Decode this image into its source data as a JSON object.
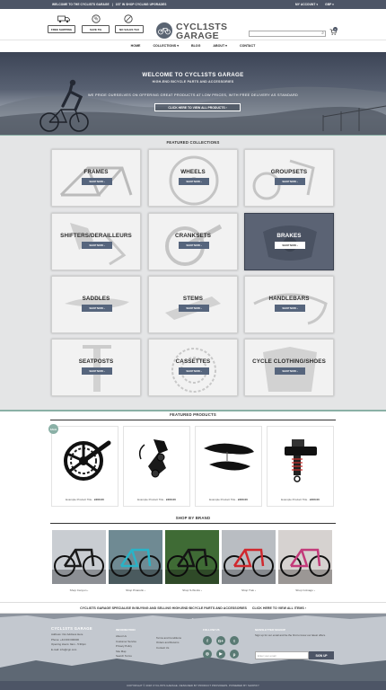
{
  "topbar": {
    "left": [
      "WELCOME TO THE CYCLISTS GARAGE",
      "|",
      "1ST IN SHOP CYCLING UPGRADES"
    ],
    "account": "MY ACCOUNT",
    "currency": "GBP"
  },
  "header": {
    "badges": [
      "FREE SHIPPING",
      "SAVE 5%",
      "NO SALES TAX"
    ],
    "badge_icons": [
      "truck-icon",
      "percent-icon",
      "tag-icon"
    ],
    "logo_line1": "CYCL1STS",
    "logo_line2": "GARAGE",
    "cart_count": "0",
    "search_icon": "search-icon"
  },
  "nav": {
    "items": [
      "HOME",
      "COLLECTIONS ▾",
      "BLOG",
      "ABOUT ▾",
      "CONTACT"
    ]
  },
  "hero": {
    "title": "WELCOME TO CYCL1STS GARAGE",
    "subtitle": "HIGH-END BICYCLE PARTS AND ACCESSORIES",
    "tagline": "WE PRIDE OURSELVES ON OFFERING GREAT PRODUCTS AT LOW PRICES, WITH FREE DELIVERY AS STANDARD",
    "cta": "CLICK HERE TO VIEW ALL PRODUCTS ›"
  },
  "collections": {
    "title": "FEATURED COLLECTIONS",
    "button": "SHOP NOW ›",
    "items": [
      "FRAMES",
      "WHEELS",
      "GROUPSETS",
      "SHIFTERS/DERAILLEURS",
      "CRANKSETS",
      "BRAKES",
      "SADDLES",
      "STEMS",
      "HANDLEBARS",
      "SEATPOSTS",
      "CASSETTES",
      "CYCLE CLOTHING/SHOES"
    ],
    "highlighted": "BRAKES"
  },
  "products": {
    "title": "FEATURED PRODUCTS",
    "sale_label": "SALE",
    "items": [
      {
        "name": "Example Product Title",
        "price": "£000.00"
      },
      {
        "name": "Example Product Title",
        "price": "£000.00"
      },
      {
        "name": "Example Product Title",
        "price": "£000.00"
      },
      {
        "name": "Example Product Title",
        "price": "£000.00"
      }
    ]
  },
  "brands": {
    "title": "SHOP BY BRAND",
    "items": [
      "Shop Canyon ›",
      "Shop Pinarello ›",
      "Shop S-Works ›",
      "Shop Trek ›",
      "Shop Colnago ›"
    ]
  },
  "band": {
    "text": "CYCLISTS GARAGE SPECIALISE IN BUYING AND SELLING HIGH-END BICYCLE PARTS AND ACCESSORIES",
    "link": "CLICK HERE TO VIEW ALL ITEMS ›"
  },
  "footer": {
    "logo": "CYCL1STS GARAGE",
    "contact": [
      "Address: Our Address Here",
      "Phone: +44 000 000000",
      "Opening Hours: 9am - 5:30pm",
      "E-mail: info@cgn.com"
    ],
    "info_title": "INFORMATION",
    "info_links": [
      "About Us",
      "Customer Service",
      "Privacy Policy",
      "Site Map",
      "Search Terms"
    ],
    "info_links2": [
      "Terms and Conditions",
      "Orders and Returns",
      "Contact Us"
    ],
    "follow_title": "FOLLOW US",
    "social": [
      "f",
      "G+",
      "t",
      "◎",
      "▶",
      "p"
    ],
    "news_title": "NEWSLETTER SIGNUP",
    "news_text": "Sign up for our email and be the first to know our latest offers.",
    "news_placeholder": "Enter your email",
    "news_button": "SIGN UP",
    "copyright": "COPYRIGHT © 2018 CYCLISTS GARAGE. DESIGNED BY PRODUCT PROVIDERS. POWERED BY SHOPIFY"
  },
  "colors": {
    "topbar": "#4d5566",
    "accent": "#8ab0a6",
    "button": "#56657d",
    "footer": "#c3c8cf"
  }
}
